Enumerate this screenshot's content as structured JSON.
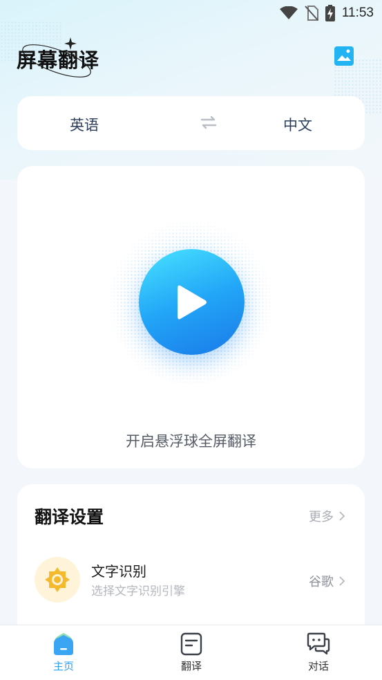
{
  "status_bar": {
    "time": "11:53"
  },
  "header": {
    "title": "屏幕翻译"
  },
  "language": {
    "source": "英语",
    "target": "中文"
  },
  "floating": {
    "caption": "开启悬浮球全屏翻译"
  },
  "settings": {
    "title": "翻译设置",
    "more_label": "更多",
    "ocr": {
      "title": "文字识别",
      "subtitle": "选择文字识别引擎",
      "value": "谷歌"
    }
  },
  "nav": {
    "items": [
      {
        "label": "主页"
      },
      {
        "label": "翻译"
      },
      {
        "label": "对话"
      }
    ]
  },
  "colors": {
    "accent": "#2aa0f2",
    "play_gradient_start": "#49e3ff",
    "play_gradient_end": "#1a79e8",
    "ocr_icon": "#f5b92e"
  }
}
